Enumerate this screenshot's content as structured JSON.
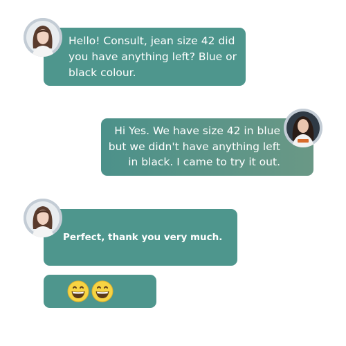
{
  "messages": [
    {
      "sender": "customer",
      "text": "Hello! Consult, jean size 42 did you have anything left? Blue or black colour."
    },
    {
      "sender": "store",
      "text": "Hi Yes. We have size 42 in blue but we didn't have anything left in black. I came to try it out."
    },
    {
      "sender": "customer",
      "text": "Perfect, thank you very much."
    },
    {
      "sender": "customer",
      "emojis": [
        "grinning-face-emoji",
        "grinning-face-emoji"
      ]
    }
  ],
  "colors": {
    "bubble": "#4e968d",
    "bubble_alt": "#6a9886",
    "text": "#ffffff",
    "avatar_ring": "#b8c4cf"
  }
}
